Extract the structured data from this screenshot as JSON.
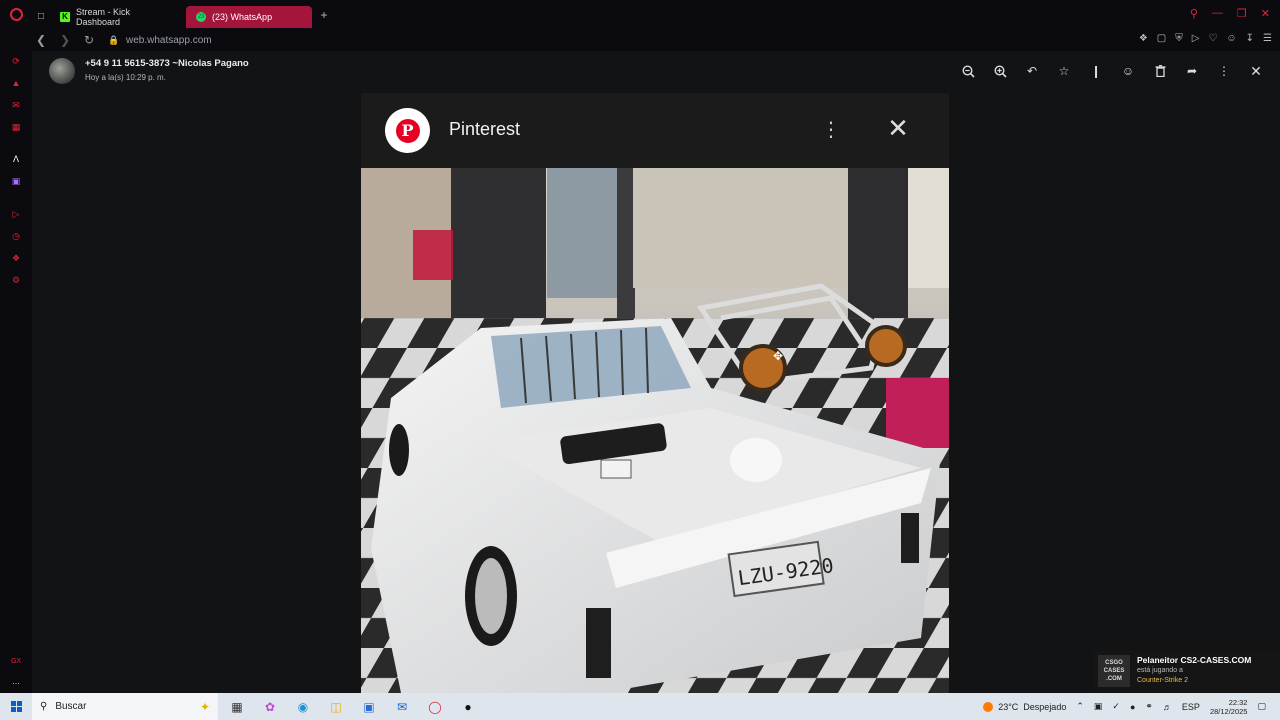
{
  "browser": {
    "tabs": [
      {
        "label": "Stream - Kick Dashboard",
        "favicon": "K"
      },
      {
        "label": "(23) WhatsApp",
        "favicon": "23"
      }
    ],
    "url": "web.whatsapp.com",
    "accent": "#e0243a"
  },
  "viewer": {
    "sender_name": "+54 9 11 5615-3873 ~Nicolas Pagano",
    "sender_time": "Hoy a la(s) 10:29 p. m.",
    "tools": [
      "zoom-out-icon",
      "zoom-in-icon",
      "reply-icon",
      "star-icon",
      "pin-icon",
      "emoji-icon",
      "trash-icon",
      "forward-icon",
      "more-icon",
      "close-icon"
    ]
  },
  "image": {
    "app_label": "Pinterest",
    "plate": "LZU-9220"
  },
  "notification": {
    "title": "Pelaneitor CS2-CASES.COM",
    "sub": "está jugando a",
    "game": "Counter-Strike 2",
    "logo_line1": "CSGO",
    "logo_line2": "CASES",
    "logo_line3": ".COM"
  },
  "taskbar": {
    "search_placeholder": "Buscar",
    "temperature": "23°C",
    "weather": "Despejado",
    "language": "ESP",
    "time": "22:32",
    "date": "28/12/2025"
  },
  "sidebar": {
    "bottom_label": "..."
  }
}
